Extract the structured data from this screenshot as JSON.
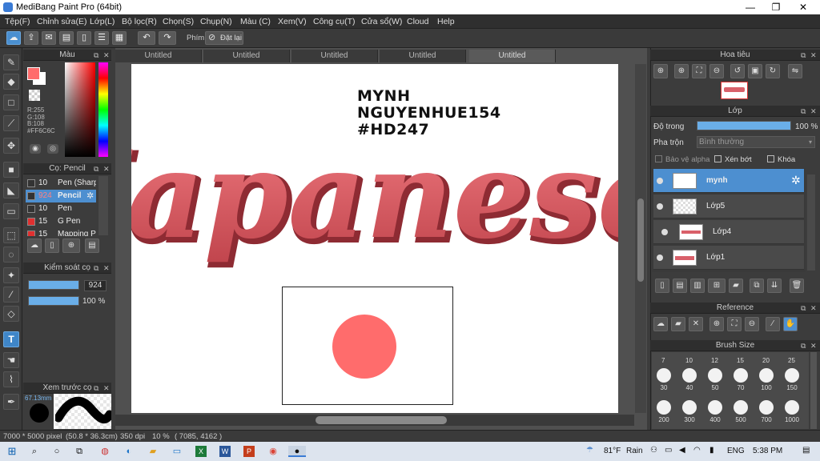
{
  "app": {
    "title": "MediBang Paint Pro (64bit)"
  },
  "menu": [
    "Tệp(F)",
    "Chỉnh sửa(E)",
    "Lớp(L)",
    "Bộ lọc(R)",
    "Chọn(S)",
    "Chụp(N)",
    "Màu (C)",
    "Xem(V)",
    "Công cụ(T)",
    "Cửa sổ(W)",
    "Cloud",
    "Help"
  ],
  "toolbar": {
    "shortcut_label": "Phím",
    "reset_label": "Đặt lại"
  },
  "tabs": [
    "Untitled",
    "Untitled",
    "Untitled",
    "Untitled",
    "Untitled"
  ],
  "color_panel": {
    "title": "Màu",
    "r": "R:255",
    "g": "G:108",
    "b": "B:108",
    "hex": "#FF6C6C",
    "fg": "#ff6c6c",
    "bg": "#ffffff"
  },
  "brush_panel": {
    "title": "Cọ: Pencil",
    "items": [
      {
        "size": "10",
        "name": "Pen (Sharp",
        "color": "#333333"
      },
      {
        "size": "924",
        "name": "Pencil",
        "color": "#333333"
      },
      {
        "size": "10",
        "name": "Pen",
        "color": "#333333"
      },
      {
        "size": "15",
        "name": "G Pen",
        "color": "#e03030"
      },
      {
        "size": "15",
        "name": "Mapping Pe",
        "color": "#e03030"
      }
    ]
  },
  "brush_control": {
    "title": "Kiểm soát cọ",
    "size": "924",
    "opacity": "100 %",
    "size_fill": 1.0,
    "opacity_fill": 1.0
  },
  "brush_preview": {
    "title": "Xem trước cọ",
    "size_label": "67.13mm"
  },
  "canvas": {
    "text_lines": [
      "MYNH",
      "NGUYENHUE154",
      "#HD247"
    ],
    "lettering": "Japanese",
    "lettering_color": "#e0646a"
  },
  "navigator": {
    "title": "Hoa tiêu"
  },
  "layers": {
    "title": "Lớp",
    "opacity_label": "Độ trong",
    "opacity_value": "100 %",
    "blend_label": "Pha trộn",
    "blend_value": "Bình thường",
    "protect_alpha": "Bảo vệ alpha",
    "clip": "Xén bớt",
    "lock": "Khóa",
    "items": [
      {
        "name": "mynh"
      },
      {
        "name": "Lớp5"
      },
      {
        "name": "Lớp4"
      },
      {
        "name": "Lớp1"
      }
    ]
  },
  "reference": {
    "title": "Reference"
  },
  "brush_size": {
    "title": "Brush Size",
    "top_row": [
      "7",
      "10",
      "12",
      "15",
      "20",
      "25"
    ],
    "row2": [
      "30",
      "40",
      "50",
      "70",
      "100",
      "150"
    ],
    "row3": [
      "200",
      "300",
      "400",
      "500",
      "700",
      "1000"
    ]
  },
  "status": {
    "dims": "7000 * 5000 pixel",
    "mm": "(50.8 * 36.3cm)",
    "dpi": "350 dpi",
    "zoom": "10 %",
    "coords": "( 7085, 4162 )"
  },
  "taskbar": {
    "temp": "81°F",
    "weather": "Rain",
    "lang": "ENG",
    "time": "5:38 PM"
  }
}
